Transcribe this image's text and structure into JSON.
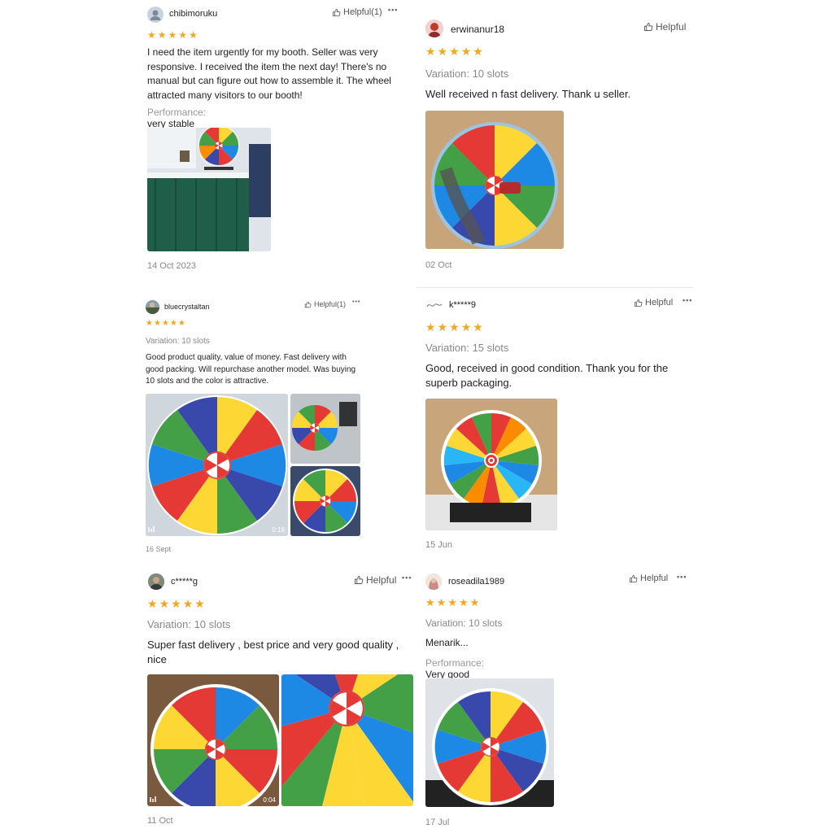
{
  "colors": {
    "star": "#f6a623",
    "wheel": [
      "#e53935",
      "#fdd835",
      "#1e88e5",
      "#43a047",
      "#3949ab",
      "#fb8c00"
    ]
  },
  "reviews": [
    {
      "user": "chibimoruku",
      "helpful": "Helpful(1)",
      "more": "•••",
      "stars": [
        "★",
        "★",
        "★",
        "★",
        "★"
      ],
      "text": "I need the item urgently for my booth. Seller was very responsive. I received the item the next day! There's no manual but can figure out how to assemble it. The wheel attracted many visitors to our booth!",
      "perf_label": "Performance:",
      "perf_value": "very stable and easy to spin",
      "date": "14 Oct 2023"
    },
    {
      "user": "erwinanur18",
      "helpful": "Helpful",
      "stars": [
        "★",
        "★",
        "★",
        "★",
        "★"
      ],
      "variation": "Variation: 10 slots",
      "text": "Well received n fast delivery. Thank u seller.",
      "date": "02 Oct"
    },
    {
      "user": "bluecrystaltan",
      "helpful": "Helpful(1)",
      "more": "•••",
      "stars": [
        "★",
        "★",
        "★",
        "★",
        "★"
      ],
      "variation": "Variation: 10 slots",
      "text": "Good product quality, value of money. Fast delivery with good packing. Will repurchase another model. Was buying 10 slots and the color is attractive.",
      "video_time": "0:18",
      "date": "16 Sept"
    },
    {
      "user": "k*****9",
      "helpful": "Helpful",
      "more": "•••",
      "stars": [
        "★",
        "★",
        "★",
        "★",
        "★"
      ],
      "variation": "Variation: 15 slots",
      "text": "Good, received in good condition. Thank you for the superb packaging.",
      "date": "15 Jun"
    },
    {
      "user": "c*****g",
      "helpful": "Helpful",
      "more": "•••",
      "stars": [
        "★",
        "★",
        "★",
        "★",
        "★"
      ],
      "variation": "Variation: 10 slots",
      "text": "Super fast delivery , best price and very good quality , nice",
      "video_time": "0:04",
      "date": "11 Oct"
    },
    {
      "user": "roseadila1989",
      "helpful": "Helpful",
      "more": "•••",
      "stars": [
        "★",
        "★",
        "★",
        "★",
        "★"
      ],
      "variation": "Variation: 10 slots",
      "text": "Menarik...",
      "perf_label": "Performance:",
      "perf_value": "Very good quality..",
      "date": "17 Jul"
    }
  ]
}
